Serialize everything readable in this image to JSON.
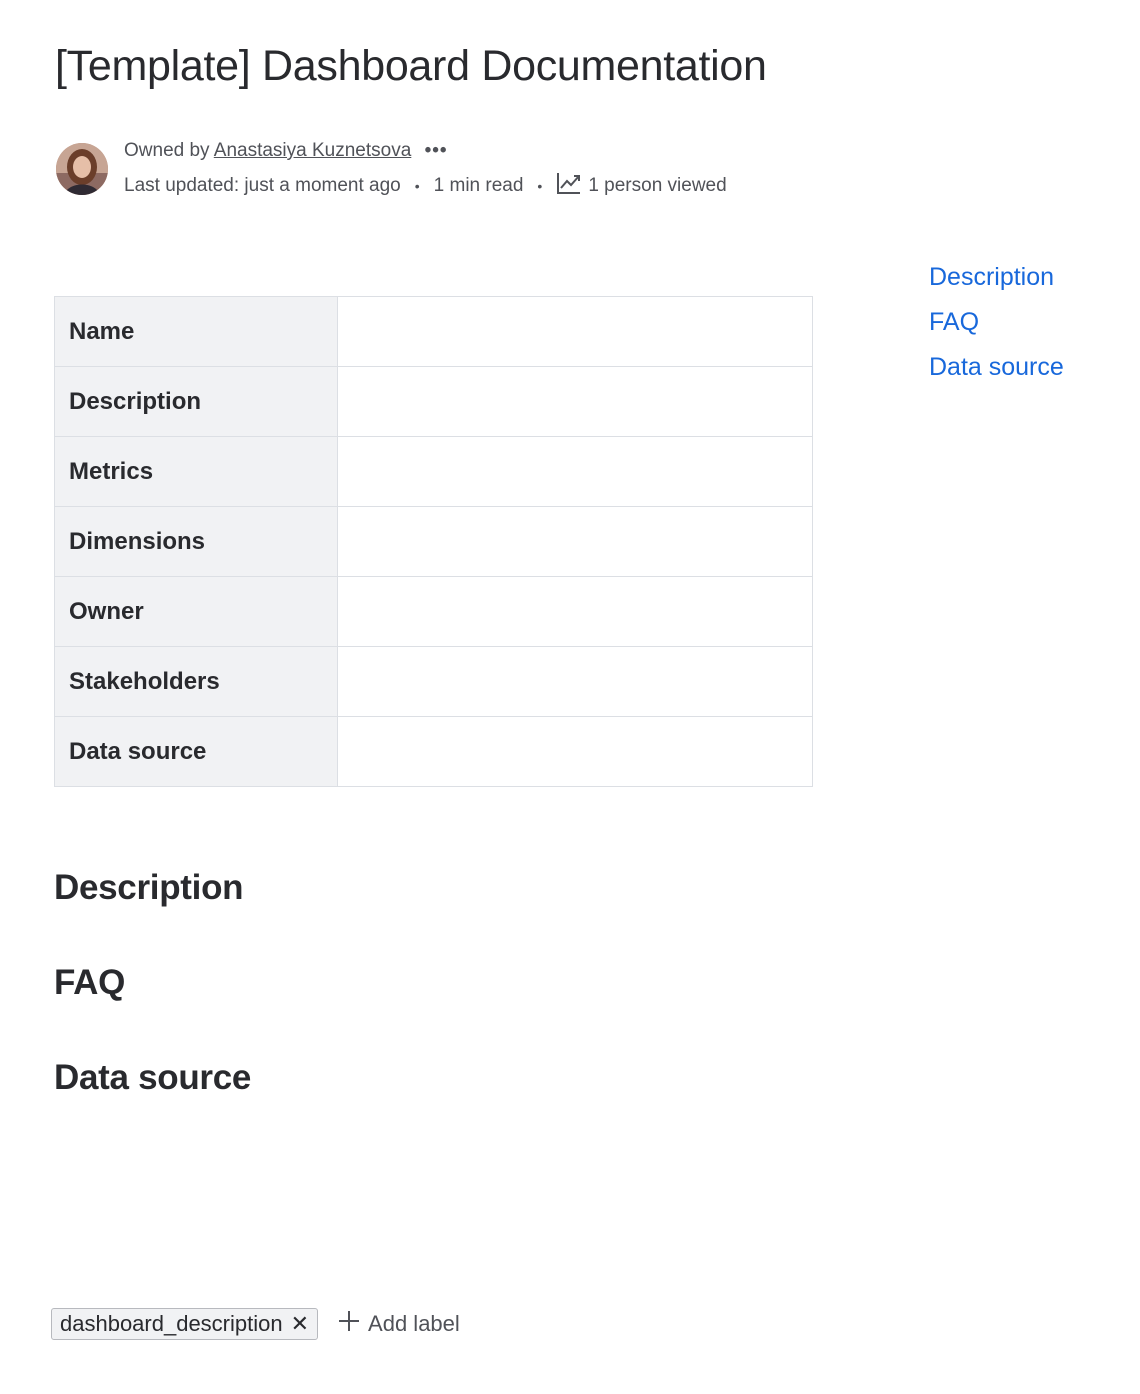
{
  "page": {
    "title": "[Template] Dashboard Documentation"
  },
  "byline": {
    "owned_by_prefix": "Owned by",
    "owner_name": "Anastasiya Kuznetsova",
    "more_actions": "•••",
    "last_updated": "Last updated: just a moment ago",
    "read_time": "1 min read",
    "views": "1 person viewed",
    "separator": "•"
  },
  "table": {
    "rows": [
      {
        "label": "Name",
        "value": ""
      },
      {
        "label": "Description",
        "value": ""
      },
      {
        "label": "Metrics",
        "value": ""
      },
      {
        "label": "Dimensions",
        "value": ""
      },
      {
        "label": "Owner",
        "value": ""
      },
      {
        "label": "Stakeholders",
        "value": ""
      },
      {
        "label": "Data source",
        "value": ""
      }
    ]
  },
  "toc": {
    "items": [
      "Description",
      "FAQ",
      "Data source"
    ]
  },
  "sections": {
    "description": "Description",
    "faq": "FAQ",
    "data_source": "Data source"
  },
  "labels": {
    "items": [
      "dashboard_description"
    ],
    "remove_glyph": "✕",
    "add_label": "Add label"
  },
  "icons": {
    "more": "more-dots-icon",
    "views": "trend-chart-icon",
    "remove": "close-icon",
    "add": "plus-icon"
  },
  "colors": {
    "link": "#1868db",
    "text": "#292a2e",
    "muted": "#505258",
    "table_header_bg": "#f1f2f4",
    "border": "#dcdfe4"
  }
}
